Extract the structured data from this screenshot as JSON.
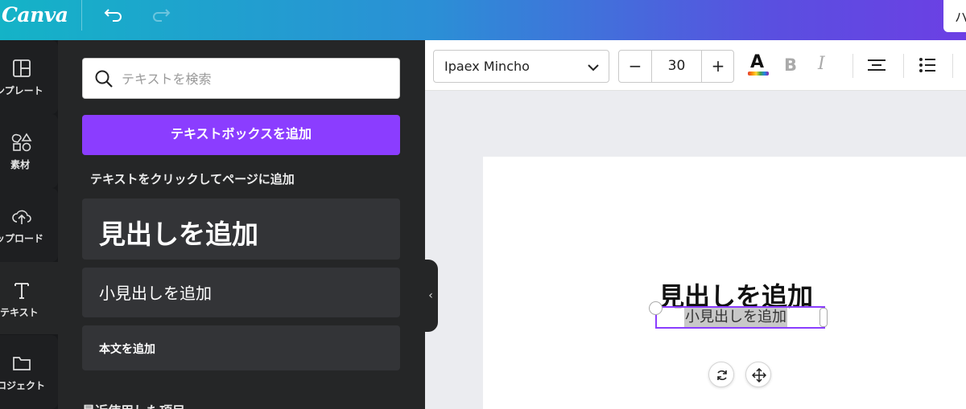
{
  "topbar": {
    "logo": "Canva",
    "right_button_label": "ハ"
  },
  "rail": {
    "items": [
      {
        "label": "ンプレート",
        "icon": "template-icon"
      },
      {
        "label": "素材",
        "icon": "elements-icon"
      },
      {
        "label": "ップロード",
        "icon": "upload-cloud-icon"
      },
      {
        "label": "テキスト",
        "icon": "text-icon"
      },
      {
        "label": "ロジェクト",
        "icon": "folder-icon"
      }
    ]
  },
  "panel": {
    "search_placeholder": "テキストを検索",
    "add_textbox_label": "テキストボックスを追加",
    "subtitle": "テキストをクリックしてページに追加",
    "heading_label": "見出しを追加",
    "subheading_label": "小見出しを追加",
    "body_label": "本文を追加",
    "recent_title": "最近使用した項目"
  },
  "toolbar": {
    "font_name": "Ipaex Mincho",
    "font_size": "30",
    "minus_label": "−",
    "plus_label": "+",
    "bold_label": "B",
    "italic_label": "I",
    "color_label": "A"
  },
  "canvas": {
    "heading_text": "見出しを追加",
    "subheading_text": "小見出しを追加"
  },
  "colors": {
    "accent": "#8b3dff",
    "panel_bg": "#252627",
    "rail_bg": "#18191b"
  }
}
